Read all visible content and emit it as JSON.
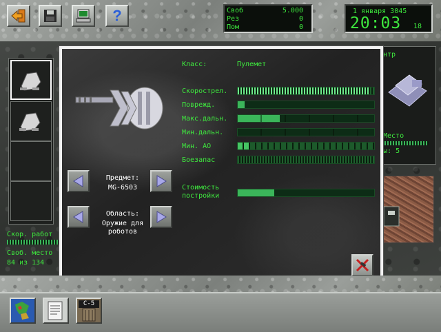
{
  "toolbar": {
    "buttons": [
      {
        "name": "back",
        "icon": "exit-arrow-icon"
      },
      {
        "name": "save",
        "icon": "floppy-disk-icon"
      },
      {
        "name": "computer",
        "icon": "computer-icon"
      },
      {
        "name": "help",
        "icon": "question-icon",
        "label": "?"
      }
    ]
  },
  "resources": {
    "free_label": "Своб",
    "free_value": "5.000",
    "reserve_label": "Рез",
    "reserve_value": "0",
    "help_label": "Пом",
    "help_value": "0"
  },
  "clock": {
    "date": "1 января 3045",
    "time": "20:03",
    "seconds": "18"
  },
  "left_panel": {
    "speed_label": "Скор. работ",
    "free_space_label": "Своб. место",
    "free_space_value": "84 из 134"
  },
  "right_panel": {
    "center_label": "нтр",
    "place_label": "Место",
    "count_label": "ты: 5"
  },
  "dialog": {
    "class_label": "Класс:",
    "class_value": "Пулемет",
    "stats": [
      {
        "label": "Скорострел.",
        "value": 0.97
      },
      {
        "label": "Поврежд.",
        "value": 0.05
      },
      {
        "label": "Макс.дальн.",
        "value": 0.31
      },
      {
        "label": "Мин.дальн.",
        "value": 0.0
      },
      {
        "label": "Мин. AO",
        "value": 0.09
      },
      {
        "label": "Боезапас",
        "value": 0.0
      }
    ],
    "cost_label_1": "Стоимость",
    "cost_label_2": "постройки",
    "cost_value": 0.27,
    "item_label": "Предмет:",
    "item_value": "MG-6503",
    "area_label": "Область:",
    "area_value_1": "Оружие для",
    "area_value_2": "роботов"
  },
  "bottom_bar": {
    "icons": [
      "planet-map-icon",
      "document-icon",
      "sector-icon"
    ],
    "sector_label": "C-5"
  },
  "colors": {
    "lcd_green": "#3ee83e",
    "bar_fill": "#3bb55a",
    "dialog_border": "#f2f2f2"
  }
}
